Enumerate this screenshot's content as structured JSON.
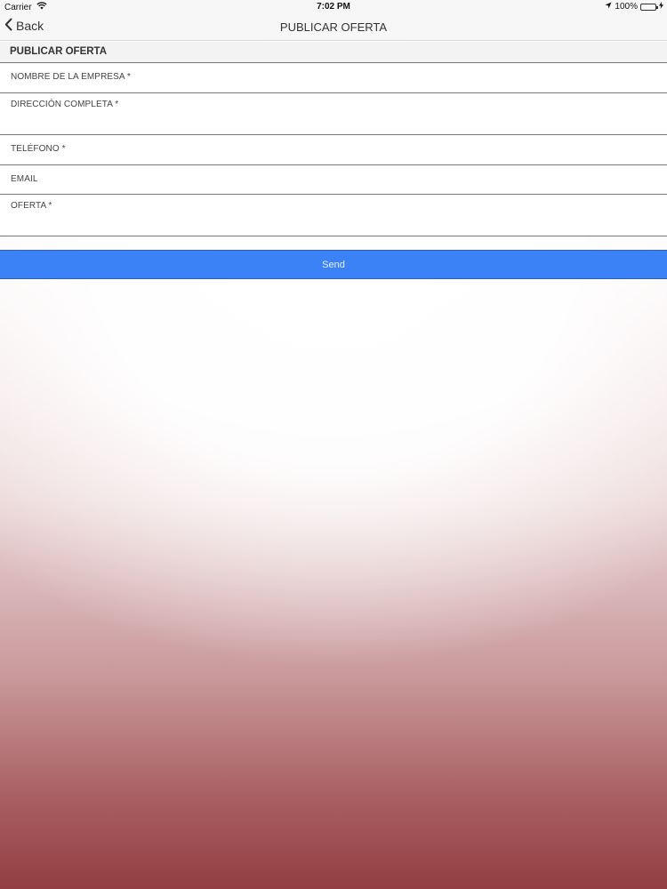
{
  "status_bar": {
    "carrier": "Carrier",
    "time": "7:02 PM",
    "battery": "100%",
    "battery_level": 1.0,
    "wifi_icon": "wifi-icon",
    "location_icon": "location-arrow-icon",
    "charging_icon": "charging-bolt-icon"
  },
  "nav": {
    "back_label": "Back",
    "back_icon": "chevron-left-icon",
    "title": "PUBLICAR OFERTA"
  },
  "form": {
    "section_title": "PUBLICAR OFERTA",
    "fields": [
      {
        "label": "NOMBRE DE LA EMPRESA *",
        "value": "",
        "placeholder": ""
      },
      {
        "label": "DIRECCIÓN COMPLETA *",
        "value": "",
        "placeholder": ""
      },
      {
        "label": "TELÉFONO *",
        "value": "",
        "placeholder": ""
      },
      {
        "label": "EMAIL",
        "value": "",
        "placeholder": ""
      },
      {
        "label": "OFERTA *",
        "value": "",
        "placeholder": ""
      }
    ],
    "send_label": "Send"
  },
  "colors": {
    "accent": "#3b82f6",
    "battery": "#4cd964",
    "background_bottom": "#933e42"
  }
}
